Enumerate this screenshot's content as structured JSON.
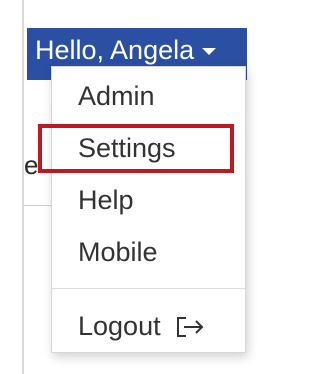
{
  "header": {
    "greeting_label": "Hello, Angela"
  },
  "background": {
    "partial_text": "e"
  },
  "menu": {
    "items": [
      {
        "label": "Admin"
      },
      {
        "label": "Settings"
      },
      {
        "label": "Help"
      },
      {
        "label": "Mobile"
      }
    ],
    "logout_label": "Logout"
  },
  "annotation": {
    "highlight_color": "#c0181f"
  },
  "colors": {
    "header_bg": "#2a4fa3",
    "header_text": "#ffffff",
    "menu_text": "#333333"
  },
  "icons": {
    "caret": "chevron-down-icon",
    "logout": "logout-icon"
  }
}
